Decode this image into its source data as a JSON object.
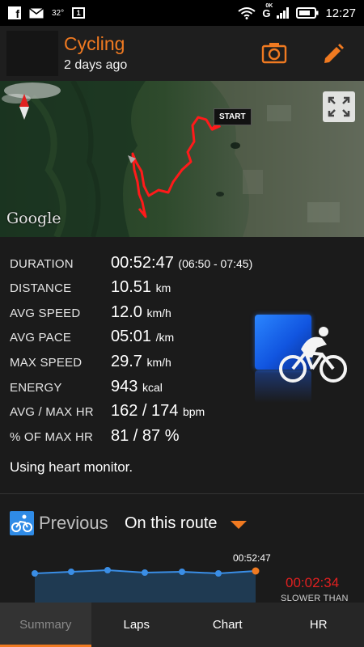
{
  "status_bar": {
    "temperature": "32°",
    "notification_count": "1",
    "network": "G",
    "network_sub": "0K",
    "time": "12:27"
  },
  "header": {
    "title": "Cycling",
    "subtitle": "2 days ago"
  },
  "map": {
    "start_label": "START",
    "attribution": "Google"
  },
  "stats": [
    {
      "label": "DURATION",
      "value": "00:52:47",
      "unit": "",
      "extra": "(06:50 - 07:45)"
    },
    {
      "label": "DISTANCE",
      "value": "10.51",
      "unit": "km",
      "extra": ""
    },
    {
      "label": "AVG SPEED",
      "value": "12.0",
      "unit": "km/h",
      "extra": ""
    },
    {
      "label": "AVG PACE",
      "value": "05:01",
      "unit": "/km",
      "extra": ""
    },
    {
      "label": "MAX SPEED",
      "value": "29.7",
      "unit": "km/h",
      "extra": ""
    },
    {
      "label": "ENERGY",
      "value": "943",
      "unit": "kcal",
      "extra": ""
    },
    {
      "label": "AVG / MAX HR",
      "value": "162 / 174",
      "unit": "bpm",
      "extra": ""
    },
    {
      "label": "% OF MAX HR",
      "value": "81 / 87 %",
      "unit": "",
      "extra": ""
    }
  ],
  "monitor_note": "Using heart monitor.",
  "previous": {
    "label": "Previous",
    "selected": "On this route",
    "chart_end_time": "00:52:47",
    "difference": "00:02:34",
    "difference_label": "SLOWER THAN"
  },
  "tabs": [
    {
      "label": "Summary",
      "active": true
    },
    {
      "label": "Laps",
      "active": false
    },
    {
      "label": "Chart",
      "active": false
    },
    {
      "label": "HR",
      "active": false
    }
  ],
  "colors": {
    "accent": "#f07a21",
    "route": "#ff1a1a",
    "slower": "#e02020",
    "previous_icon": "#2f8be6"
  }
}
